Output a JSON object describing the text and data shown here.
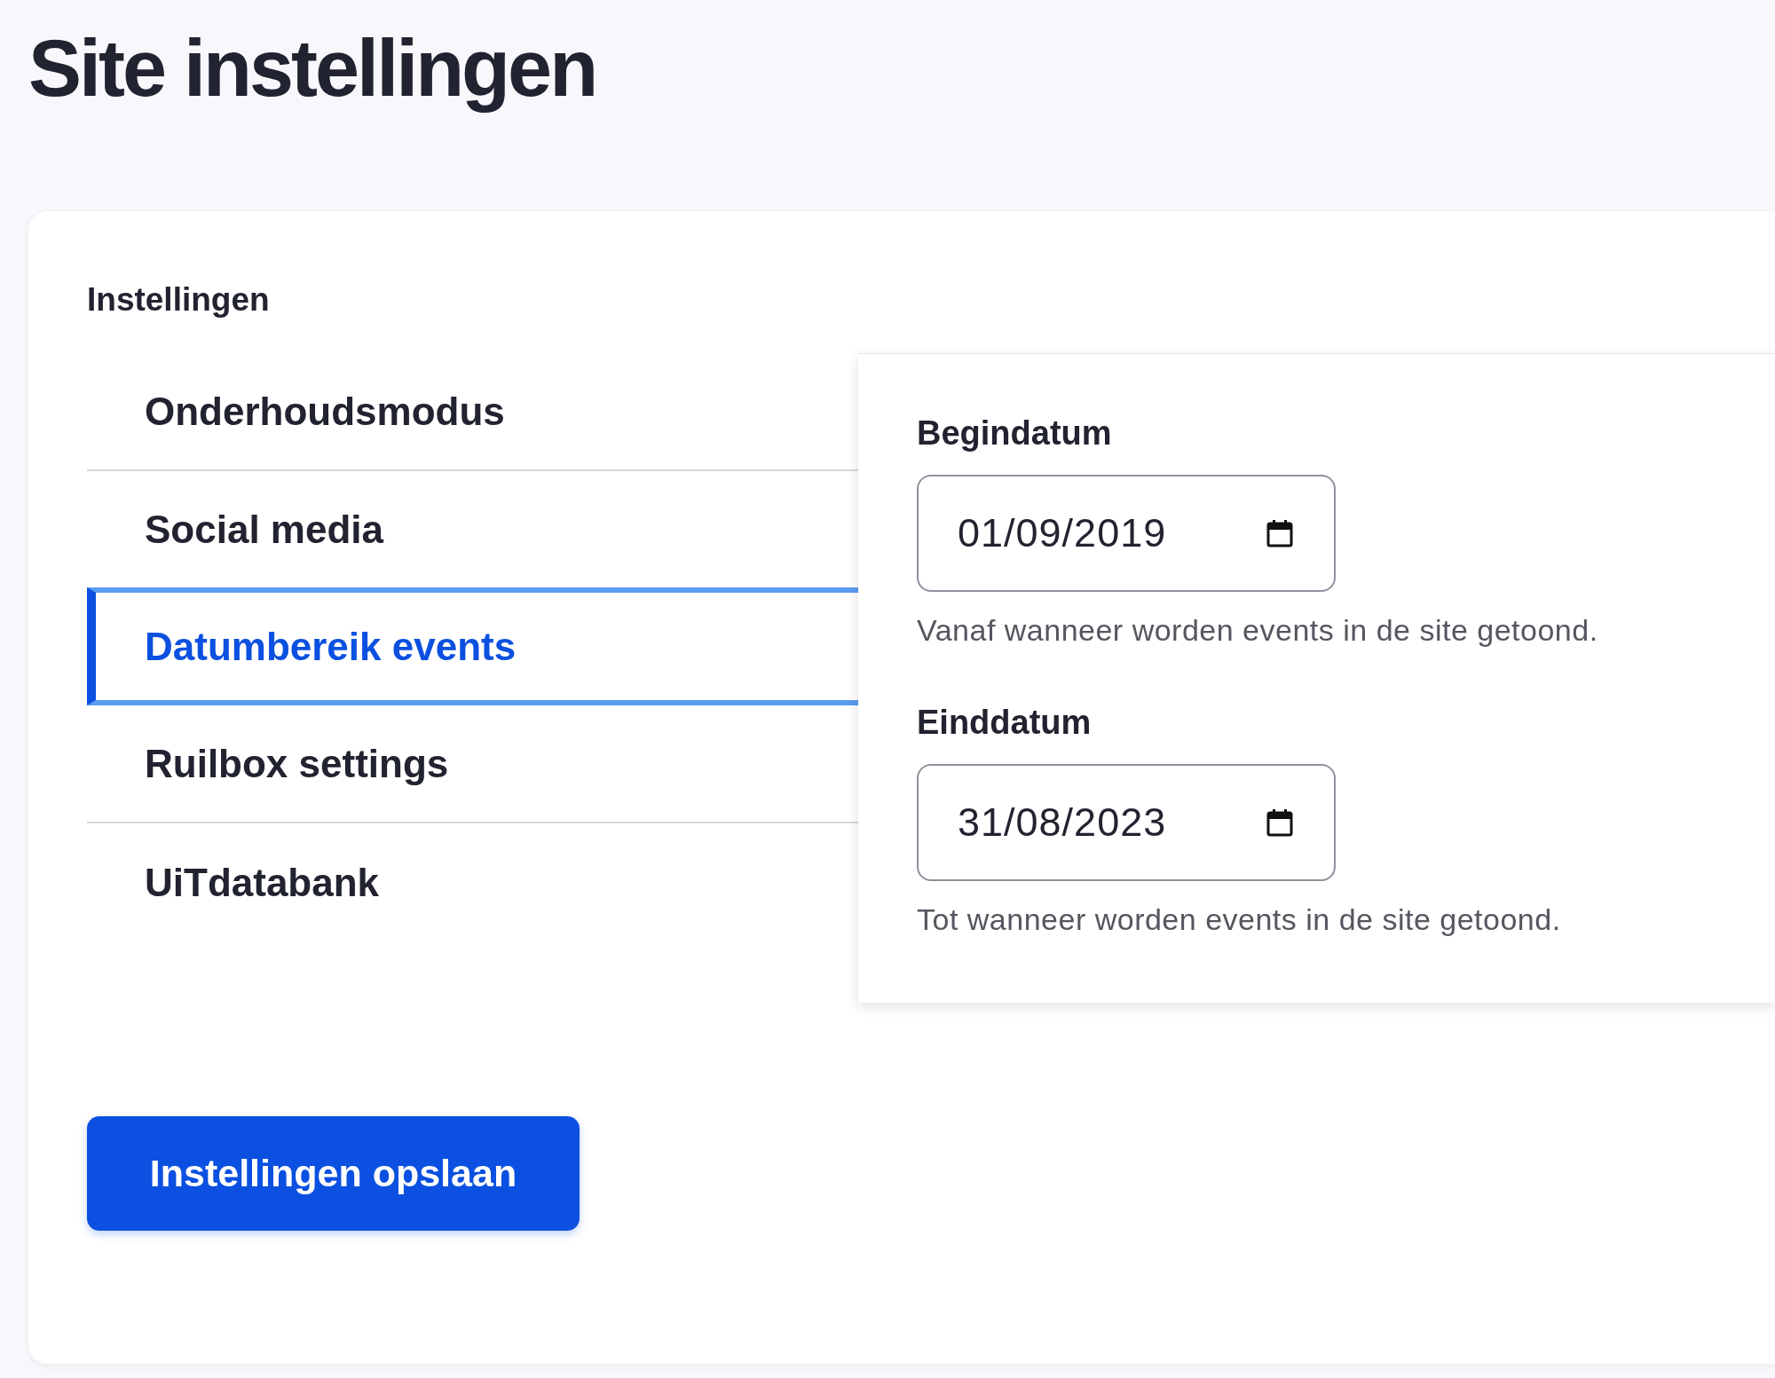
{
  "page_title": "Site instellingen",
  "section_label": "Instellingen",
  "tabs": [
    {
      "label": "Onderhoudsmodus",
      "selected": false
    },
    {
      "label": "Social media",
      "selected": false
    },
    {
      "label": "Datumbereik events",
      "selected": true
    },
    {
      "label": "Ruilbox settings",
      "selected": false
    },
    {
      "label": "UiTdatabank",
      "selected": false
    }
  ],
  "fields": [
    {
      "label": "Begindatum",
      "value": "01/09/2019",
      "help": "Vanaf wanneer worden events in de site getoond."
    },
    {
      "label": "Einddatum",
      "value": "31/08/2023",
      "help": "Tot wanneer worden events in de site getoond."
    }
  ],
  "save_button": "Instellingen opslaan"
}
